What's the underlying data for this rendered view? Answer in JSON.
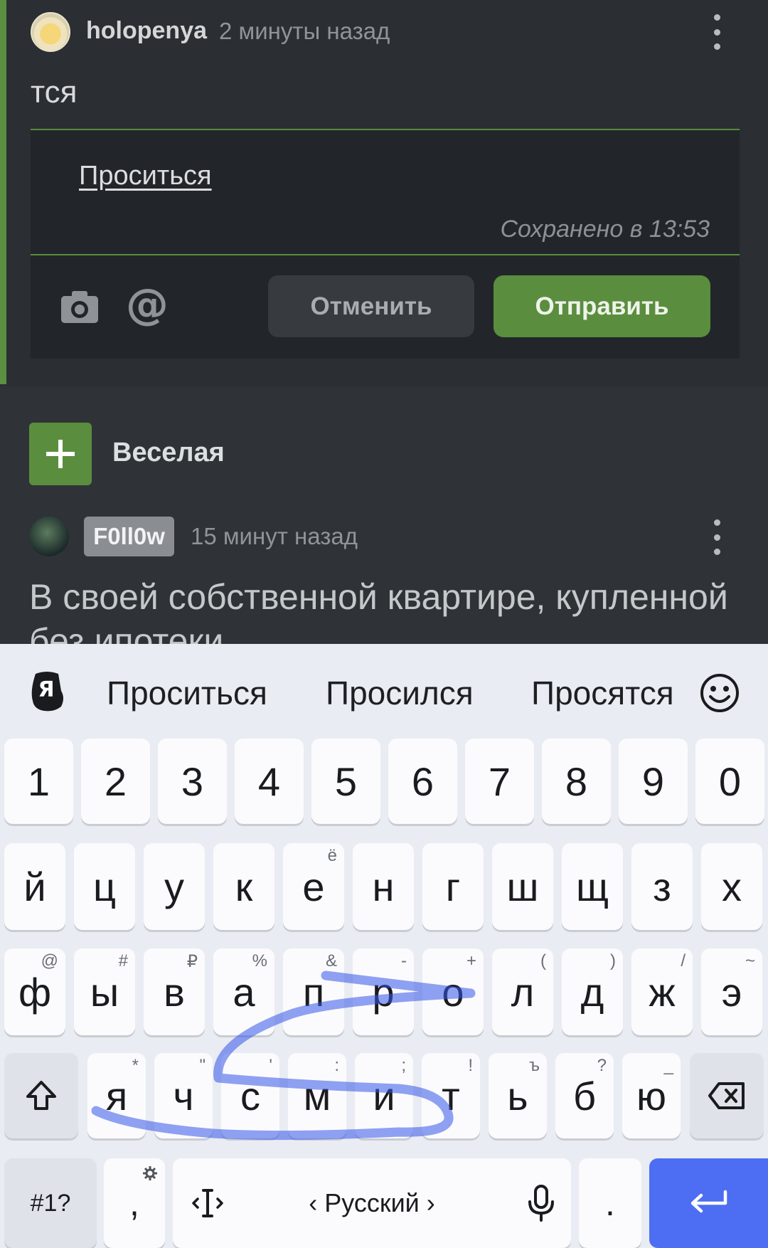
{
  "reply": {
    "username": "holopenya",
    "time": "2 минуты назад",
    "text": "тся",
    "editor_text": "Проситься",
    "saved_status": "Сохранено в 13:53",
    "cancel_label": "Отменить",
    "send_label": "Отправить"
  },
  "post": {
    "title": "Веселая",
    "author_badge": "F0ll0w",
    "time": "15 минут назад",
    "text": "В своей собственной квартире, купленной без ипотеки"
  },
  "keyboard": {
    "suggestions": [
      "Проситься",
      "Просился",
      "Просятся"
    ],
    "numbers": [
      "1",
      "2",
      "3",
      "4",
      "5",
      "6",
      "7",
      "8",
      "9",
      "0"
    ],
    "row1": [
      {
        "k": "й",
        "h": ""
      },
      {
        "k": "ц",
        "h": ""
      },
      {
        "k": "у",
        "h": ""
      },
      {
        "k": "к",
        "h": ""
      },
      {
        "k": "е",
        "h": "ё"
      },
      {
        "k": "н",
        "h": ""
      },
      {
        "k": "г",
        "h": ""
      },
      {
        "k": "ш",
        "h": ""
      },
      {
        "k": "щ",
        "h": ""
      },
      {
        "k": "з",
        "h": ""
      },
      {
        "k": "х",
        "h": ""
      }
    ],
    "row2": [
      {
        "k": "ф",
        "h": "@"
      },
      {
        "k": "ы",
        "h": "#"
      },
      {
        "k": "в",
        "h": "₽"
      },
      {
        "k": "а",
        "h": "%"
      },
      {
        "k": "п",
        "h": "&"
      },
      {
        "k": "р",
        "h": "-"
      },
      {
        "k": "о",
        "h": "+"
      },
      {
        "k": "л",
        "h": "("
      },
      {
        "k": "д",
        "h": ")"
      },
      {
        "k": "ж",
        "h": "/"
      },
      {
        "k": "э",
        "h": "~"
      }
    ],
    "row3": [
      {
        "k": "я",
        "h": "*"
      },
      {
        "k": "ч",
        "h": "\""
      },
      {
        "k": "с",
        "h": "'"
      },
      {
        "k": "м",
        "h": ":"
      },
      {
        "k": "и",
        "h": ";"
      },
      {
        "k": "т",
        "h": "!"
      },
      {
        "k": "ь",
        "h": "ъ"
      },
      {
        "k": "б",
        "h": "?"
      },
      {
        "k": "ю",
        "h": "_"
      }
    ],
    "symbols_label": "#1?",
    "comma_label": ",",
    "space_label": "‹ Русский ›",
    "period_label": "."
  }
}
